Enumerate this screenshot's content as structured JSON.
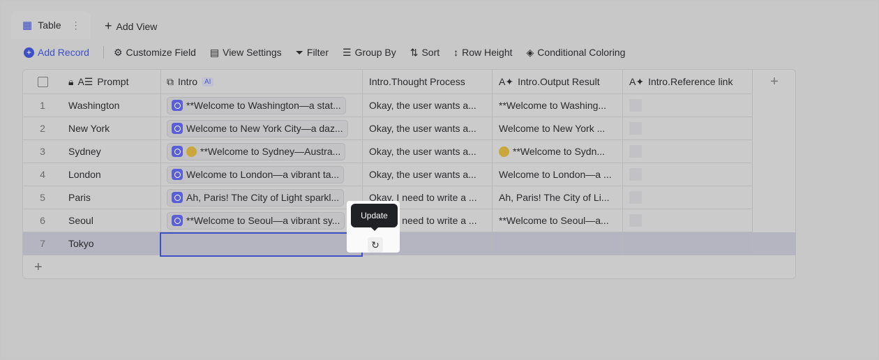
{
  "tabs": {
    "active": "Table",
    "add_view": "Add View"
  },
  "toolbar": {
    "add_record": "Add Record",
    "customize_field": "Customize Field",
    "view_settings": "View Settings",
    "filter": "Filter",
    "group_by": "Group By",
    "sort": "Sort",
    "row_height": "Row Height",
    "conditional_coloring": "Conditional Coloring"
  },
  "columns": {
    "prompt": "Prompt",
    "intro": "Intro",
    "intro_badge": "AI",
    "thought": "Intro.Thought Process",
    "output": "Intro.Output Result",
    "reference": "Intro.Reference link"
  },
  "rows": [
    {
      "n": "1",
      "prompt": "Washington",
      "intro": "**Welcome to Washington—a stat...",
      "thought": "Okay, the user wants a...",
      "output": "**Welcome to Washing...",
      "emoji": false
    },
    {
      "n": "2",
      "prompt": "New York",
      "intro": "Welcome to New York City—a daz...",
      "thought": "Okay, the user wants a...",
      "output": "Welcome to New York ...",
      "emoji": false
    },
    {
      "n": "3",
      "prompt": "Sydney",
      "intro": "**Welcome to Sydney—Austra...",
      "thought": "Okay, the user wants a...",
      "output": "**Welcome to Sydn...",
      "emoji": true
    },
    {
      "n": "4",
      "prompt": "London",
      "intro": "Welcome to London—a vibrant ta...",
      "thought": "Okay, the user wants a...",
      "output": "Welcome to London—a ...",
      "emoji": false
    },
    {
      "n": "5",
      "prompt": "Paris",
      "intro": "Ah, Paris! The City of Light sparkl...",
      "thought": "Okay, I need to write a ...",
      "output": "Ah, Paris! The City of Li...",
      "emoji": false
    },
    {
      "n": "6",
      "prompt": "Seoul",
      "intro": "**Welcome to Seoul—a vibrant sy...",
      "thought": "Okay, I need to write a ...",
      "output": "**Welcome to Seoul—a...",
      "emoji": false
    },
    {
      "n": "7",
      "prompt": "Tokyo",
      "intro": "",
      "thought": "",
      "output": "",
      "emoji": false
    }
  ],
  "tooltip": "Update",
  "colors": {
    "accent": "#3d4fc8",
    "ai_icon": "#5b5fd6"
  }
}
